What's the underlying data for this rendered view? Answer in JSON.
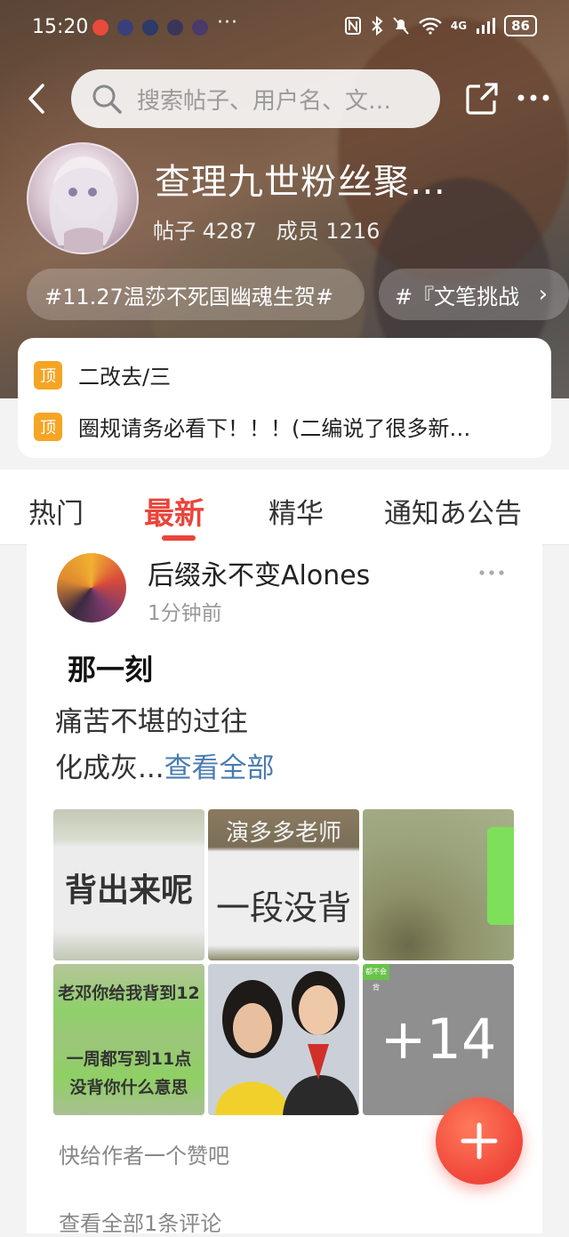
{
  "status_bar": {
    "time": "15:20",
    "more_dots": "···",
    "network": "4G",
    "battery": "86"
  },
  "search": {
    "placeholder": "搜索帖子、用户名、文…"
  },
  "forum": {
    "title": "查理九世粉丝聚…",
    "posts_label": "帖子",
    "posts_count": "4287",
    "members_label": "成员",
    "members_count": "1216"
  },
  "topic_tags": [
    {
      "label": "#11.27温莎不死国幽魂生贺#"
    },
    {
      "label": "#『文笔挑战"
    }
  ],
  "pinned": {
    "badge": "顶",
    "items": [
      {
        "text": "二改去/三"
      },
      {
        "text": "圈规请务必看下！！！(二编说了很多新…"
      }
    ]
  },
  "tabs": [
    {
      "label": "热门",
      "active": false
    },
    {
      "label": "最新",
      "active": true
    },
    {
      "label": "精华",
      "active": false
    },
    {
      "label": "通知あ公告",
      "active": false
    }
  ],
  "post": {
    "author": "后缀永不变Alones",
    "time": "1分钟前",
    "title": "那一刻",
    "body_line1": "痛苦不堪的过往",
    "body_line2": "化成灰...",
    "see_all": "查看全部",
    "images": [
      {
        "caption": "背出来呢"
      },
      {
        "caption_top": "演多多老师",
        "caption": "一段没背"
      },
      {
        "caption": ""
      },
      {
        "caption_top": "老邓你给我背到12",
        "caption": "一周都写到11点",
        "caption_bottom": "没背你什么意思"
      },
      {
        "caption": ""
      },
      {
        "more": "+14",
        "mini": "都不会背"
      }
    ],
    "like_hint": "快给作者一个赞吧",
    "comments_link": "查看全部1条评论"
  },
  "colors": {
    "accent": "#e9453a",
    "pin_badge": "#f5a524",
    "link": "#4a7bb0"
  }
}
